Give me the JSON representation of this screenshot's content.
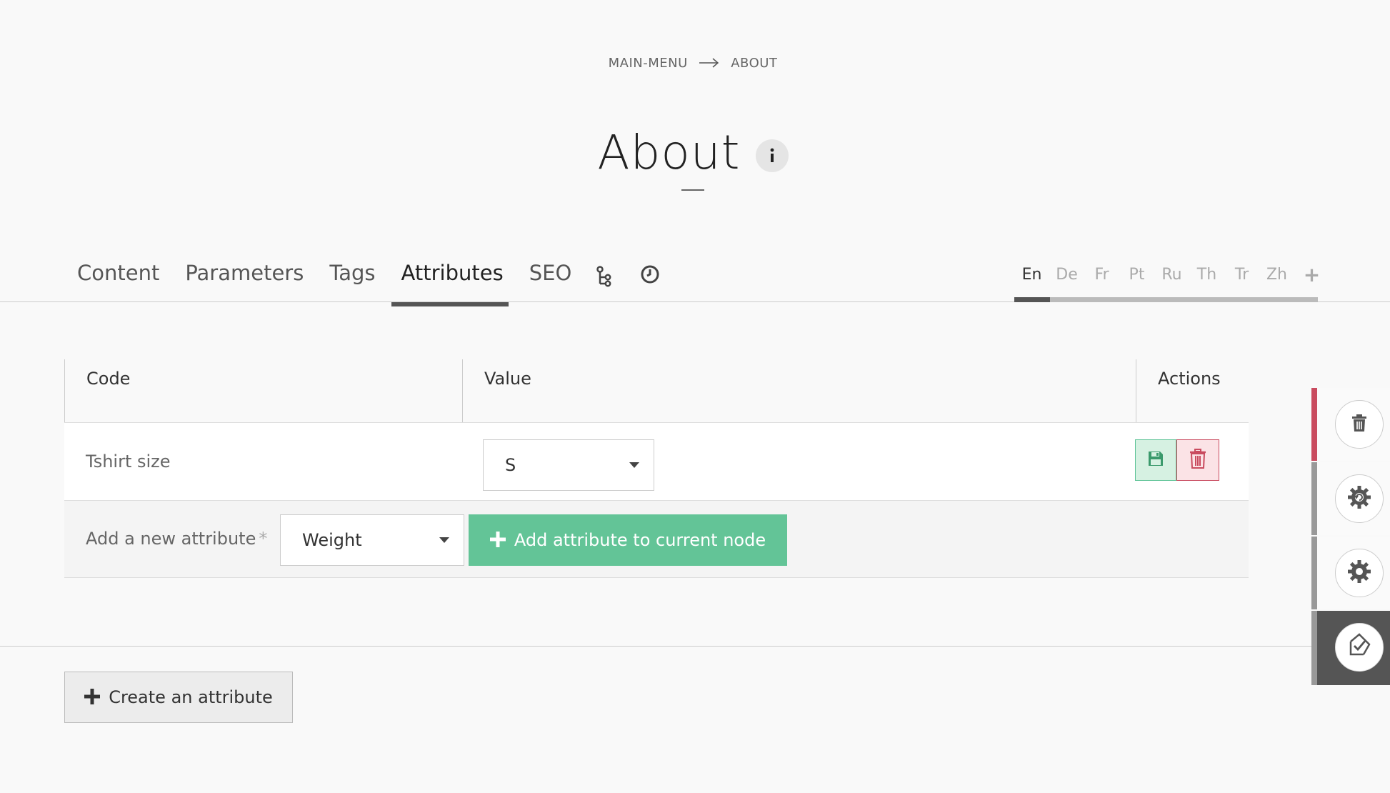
{
  "breadcrumb": {
    "parent": "MAIN-MENU",
    "current": "ABOUT"
  },
  "page": {
    "title": "About"
  },
  "tabs": [
    {
      "label": "Content"
    },
    {
      "label": "Parameters"
    },
    {
      "label": "Tags"
    },
    {
      "label": "Attributes",
      "active": true
    },
    {
      "label": "SEO"
    }
  ],
  "tab_icons": [
    "tree-icon",
    "history-icon"
  ],
  "languages": [
    {
      "code": "En",
      "active": true
    },
    {
      "code": "De"
    },
    {
      "code": "Fr"
    },
    {
      "code": "Pt"
    },
    {
      "code": "Ru"
    },
    {
      "code": "Th"
    },
    {
      "code": "Tr"
    },
    {
      "code": "Zh"
    },
    {
      "code": "+"
    }
  ],
  "table": {
    "headers": {
      "code": "Code",
      "value": "Value",
      "actions": "Actions"
    },
    "rows": [
      {
        "code": "Tshirt size",
        "value": "S"
      }
    ],
    "add_row": {
      "label": "Add a new attribute",
      "required_mark": "*",
      "selected": "Weight",
      "button": "Add attribute to current node"
    }
  },
  "create_button": "Create an attribute",
  "colors": {
    "accent_green": "#63c497",
    "danger_red": "#c94b5f",
    "dark": "#555555"
  },
  "side_actions": [
    "trash-icon",
    "gear-refresh-icon",
    "gear-icon",
    "publish-check-icon"
  ]
}
